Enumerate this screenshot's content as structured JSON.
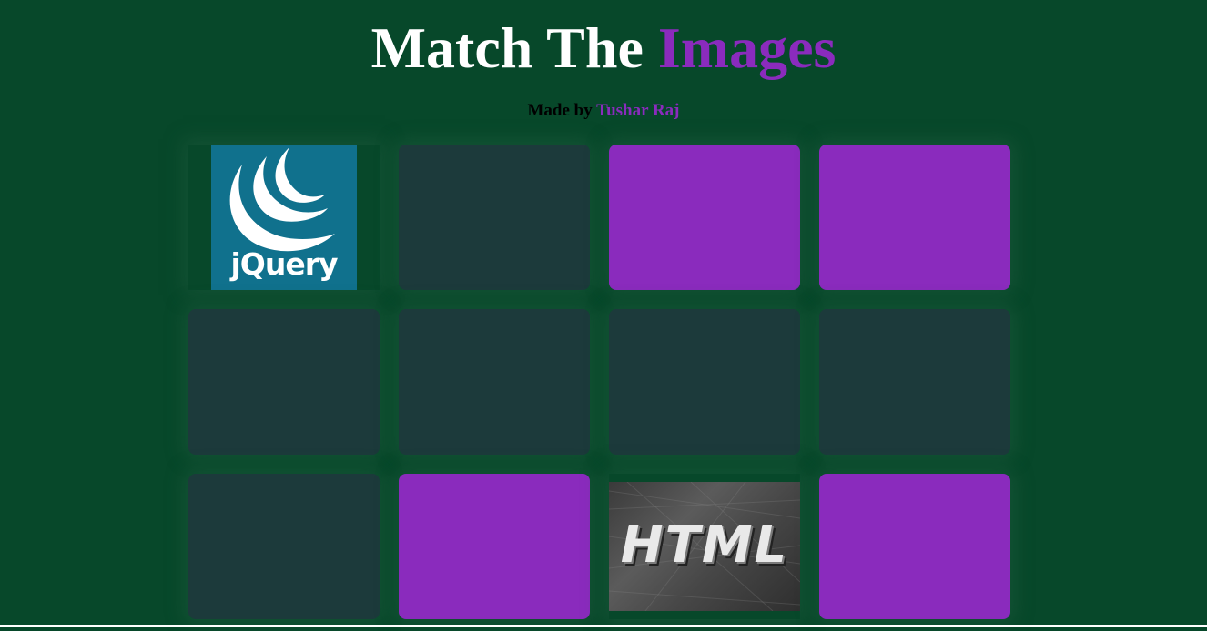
{
  "header": {
    "title_main": "Match The",
    "title_accent": "Images",
    "byline_prefix": "Made by",
    "author": "Tushar Raj"
  },
  "colors": {
    "background": "#07482a",
    "card_hidden": "#1c3a3b",
    "card_selected": "#8a2bbd",
    "accent": "#8a2bbd",
    "title": "#ffffff"
  },
  "cards": [
    {
      "state": "revealed",
      "image": "jquery-logo",
      "label": "jQuery"
    },
    {
      "state": "hidden"
    },
    {
      "state": "selected"
    },
    {
      "state": "selected"
    },
    {
      "state": "hidden"
    },
    {
      "state": "hidden"
    },
    {
      "state": "hidden"
    },
    {
      "state": "hidden"
    },
    {
      "state": "hidden"
    },
    {
      "state": "selected"
    },
    {
      "state": "revealed",
      "image": "html-logo",
      "label": "HTML"
    },
    {
      "state": "selected"
    }
  ]
}
